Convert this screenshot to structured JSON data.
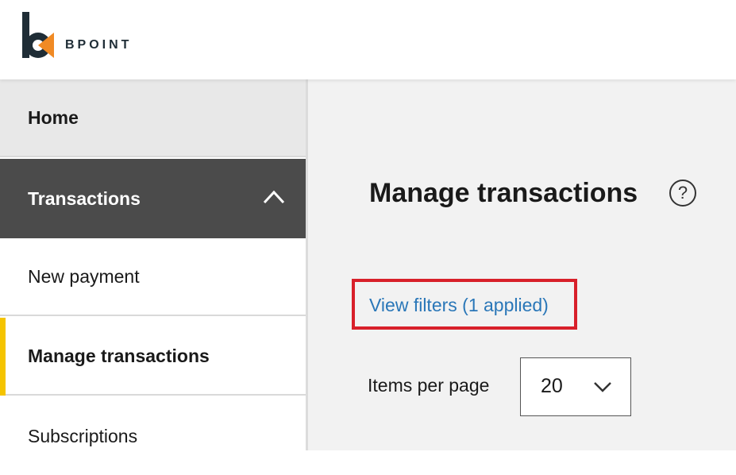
{
  "header": {
    "logo_text": "BPOINT",
    "logo_icon": "bpoint-logo-icon"
  },
  "sidebar": {
    "items": [
      {
        "label": "Home",
        "state": "default"
      },
      {
        "label": "Transactions",
        "state": "expanded",
        "icon": "chevron-up-icon"
      },
      {
        "label": "New payment",
        "state": "sub-item"
      },
      {
        "label": "Manage transactions",
        "state": "active"
      },
      {
        "label": "Subscriptions",
        "state": "sub-item"
      }
    ]
  },
  "main": {
    "title": "Manage transactions",
    "help_icon_glyph": "?",
    "filters_link": "View filters (1 applied)",
    "items_per_page": {
      "label": "Items per page",
      "value": "20",
      "icon": "chevron-down-icon"
    }
  },
  "colors": {
    "brand_dark": "#1f2d36",
    "brand_orange": "#f08a24",
    "active_indicator": "#f5c400",
    "sidebar_expanded_bg": "#4b4b4b",
    "link": "#2a77b8",
    "highlight_box": "#d8202a"
  }
}
